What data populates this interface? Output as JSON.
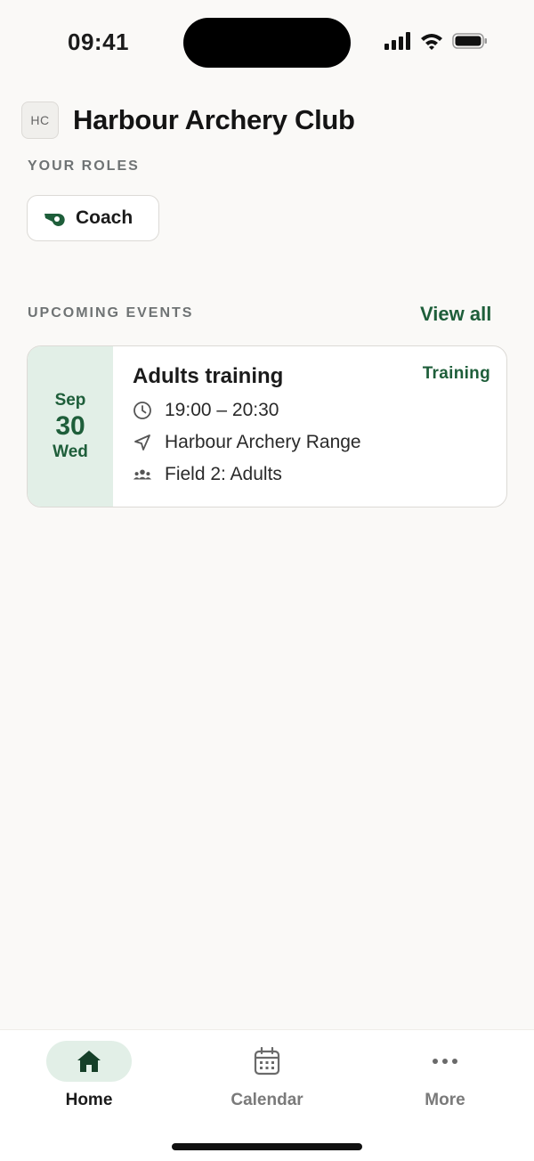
{
  "status_bar": {
    "time": "09:41"
  },
  "club": {
    "initials": "HC",
    "name": "Harbour Archery Club"
  },
  "roles": {
    "label": "YOUR ROLES",
    "items": [
      {
        "label": "Coach",
        "icon": "whistle-icon"
      }
    ]
  },
  "events": {
    "label": "UPCOMING EVENTS",
    "view_all": "View all",
    "items": [
      {
        "month": "Sep",
        "day": "30",
        "weekday": "Wed",
        "title": "Adults training",
        "type": "Training",
        "time": "19:00 – 20:30",
        "location": "Harbour Archery Range",
        "group": "Field 2: Adults"
      }
    ]
  },
  "tabs": [
    {
      "label": "Home",
      "icon": "home-icon",
      "active": true
    },
    {
      "label": "Calendar",
      "icon": "calendar-icon"
    },
    {
      "label": "More",
      "icon": "more-icon"
    }
  ],
  "colors": {
    "accent": "#1e5e3a",
    "accent_bg": "#e2efe7",
    "background": "#faf9f7"
  }
}
